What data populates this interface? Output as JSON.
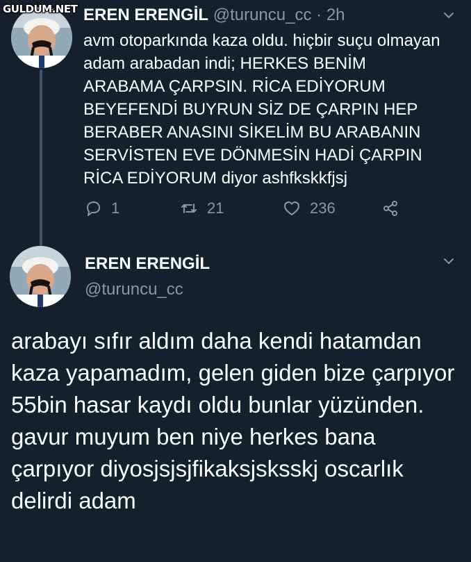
{
  "watermark": "GULDUM.NET",
  "tweet1": {
    "author_name": "EREN ERENGİL",
    "handle": "@turuncu_cc",
    "separator": "·",
    "time": "2h",
    "text": "avm otoparkında kaza oldu. hiçbir suçu olmayan adam arabadan indi; HERKES BENİM ARABAMA ÇARPSIN. RİCA EDİYORUM BEYEFENDİ BUYRUN SİZ DE ÇARPIN HEP BERABER ANASINI SİKELİM BU ARABANIN SERVİSTEN EVE DÖNMESİN HADİ ÇARPIN RİCA EDİYORUM diyor ashfkskkfjsj",
    "replies": "1",
    "retweets": "21",
    "likes": "236"
  },
  "tweet2": {
    "author_name": "EREN ERENGİL",
    "handle": "@turuncu_cc",
    "text": "arabayı sıfır aldım daha kendi hatamdan kaza yapamadım, gelen giden bize çarpıyor 55bin hasar kaydı oldu bunlar yüzünden. gavur muyum ben niye herkes bana çarpıyor diyosjsjsjfikaksjsksskj oscarlık delirdi adam"
  },
  "colors": {
    "background": "#14202c",
    "text": "#ffffff",
    "secondary": "#8899a6",
    "thread_line": "#3d5466"
  },
  "icons": [
    "reply-icon",
    "retweet-icon",
    "like-icon",
    "share-icon",
    "chevron-down-icon"
  ]
}
